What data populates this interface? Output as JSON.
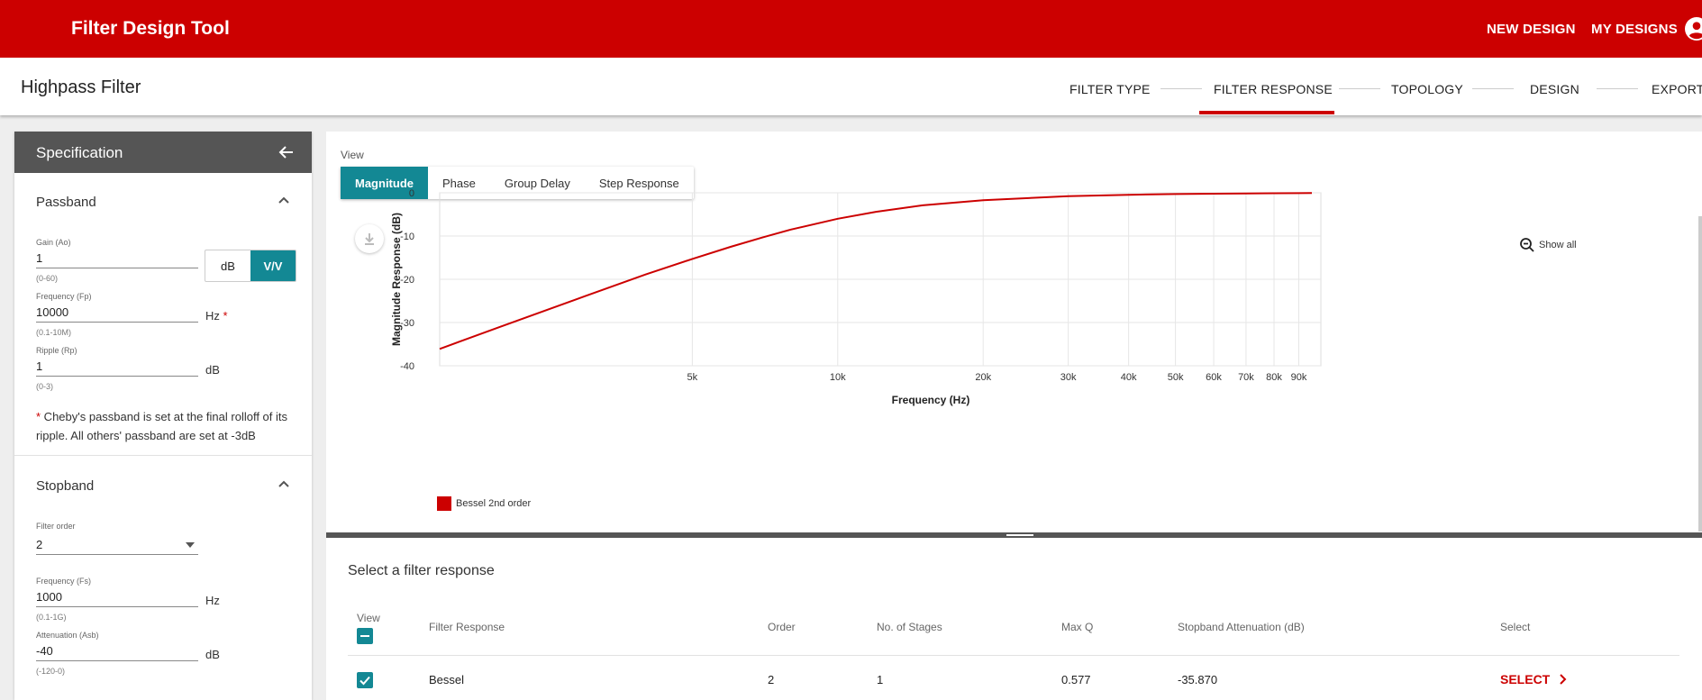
{
  "app": {
    "title": "Filter Design Tool",
    "nav": {
      "new_design": "NEW DESIGN",
      "my_designs": "MY DESIGNS"
    }
  },
  "header": {
    "page_title": "Highpass Filter",
    "steps": [
      "FILTER TYPE",
      "FILTER RESPONSE",
      "TOPOLOGY",
      "DESIGN",
      "EXPORT"
    ],
    "active_step": "FILTER RESPONSE"
  },
  "spec": {
    "title": "Specification",
    "passband": {
      "title": "Passband",
      "gain": {
        "label": "Gain (Ao)",
        "value": "1",
        "hint": "(0-60)"
      },
      "units_toggle": {
        "options": [
          "dB",
          "V/V"
        ],
        "active": "V/V"
      },
      "frequency": {
        "label": "Frequency (Fp)",
        "value": "10000",
        "hint": "(0.1-10M)",
        "unit": "Hz",
        "required": "*"
      },
      "ripple": {
        "label": "Ripple (Rp)",
        "value": "1",
        "hint": "(0-3)",
        "unit": "dB"
      },
      "note_star": "*",
      "note": " Cheby's passband is set at the final rolloff of its ripple. All others' passband are set at -3dB"
    },
    "stopband": {
      "title": "Stopband",
      "order": {
        "label": "Filter order",
        "value": "2"
      },
      "frequency": {
        "label": "Frequency (Fs)",
        "value": "1000",
        "hint": "(0.1-1G)",
        "unit": "Hz"
      },
      "attenuation": {
        "label": "Attenuation (Asb)",
        "value": "-40",
        "hint": "(-120-0)",
        "unit": "dB"
      }
    }
  },
  "view": {
    "label": "View",
    "tabs": [
      "Magnitude",
      "Phase",
      "Group Delay",
      "Step Response"
    ],
    "active_tab": "Magnitude",
    "show_all": "Show all"
  },
  "chart_data": {
    "type": "line",
    "xlabel": "Frequency (Hz)",
    "ylabel": "Magnitude Response (dB)",
    "x_scale": "log",
    "xlim": [
      1500,
      100000
    ],
    "ylim": [
      -40,
      0
    ],
    "y_ticks": [
      0,
      -10,
      -20,
      -30,
      -40
    ],
    "y_tick_labels": [
      "0",
      "-10",
      "-20",
      "-30",
      "-40"
    ],
    "x_ticks": [
      5000,
      10000,
      20000,
      30000,
      40000,
      50000,
      60000,
      70000,
      80000,
      90000
    ],
    "x_tick_labels": [
      "5k",
      "10k",
      "20k",
      "30k",
      "40k",
      "50k",
      "60k",
      "70k",
      "80k",
      "90k"
    ],
    "grid": true,
    "series": [
      {
        "name": "Bessel 2nd order",
        "color": "#cc0000",
        "x": [
          1500,
          2000,
          3000,
          4000,
          5000,
          6000,
          7000,
          8000,
          10000,
          12000,
          15000,
          20000,
          30000,
          40000,
          50000,
          60000,
          70000,
          80000,
          90000,
          100000
        ],
        "y": [
          -36.1,
          -31.0,
          -23.9,
          -18.9,
          -15.3,
          -12.5,
          -10.3,
          -8.5,
          -6.0,
          -4.4,
          -2.9,
          -1.7,
          -0.8,
          -0.45,
          -0.29,
          -0.2,
          -0.15,
          -0.11,
          -0.09,
          -0.07
        ]
      }
    ]
  },
  "table": {
    "title": "Select a filter response",
    "headers": {
      "view": "View",
      "filter_response": "Filter Response",
      "order": "Order",
      "stages": "No. of Stages",
      "max_q": "Max Q",
      "attenuation": "Stopband Attenuation (dB)",
      "select": "Select"
    },
    "rows": [
      {
        "filter_response": "Bessel",
        "order": "2",
        "stages": "1",
        "max_q": "0.577",
        "attenuation": "-35.870",
        "select": "SELECT"
      }
    ]
  }
}
